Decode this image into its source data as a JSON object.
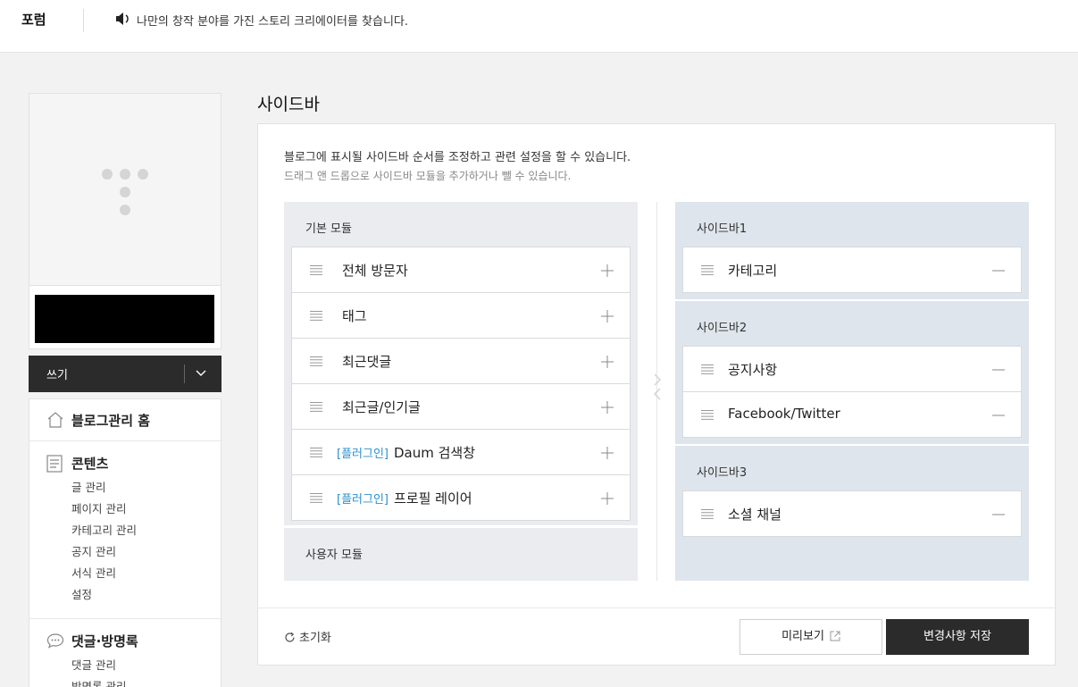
{
  "topbar": {
    "brand": "포럼",
    "notice": "나만의 창작 분야를 가진 스토리 크리에이터를 찾습니다."
  },
  "left": {
    "write_label": "쓰기",
    "home_label": "블로그관리 홈",
    "contents": {
      "title": "콘텐츠",
      "items": [
        "글 관리",
        "페이지 관리",
        "카테고리 관리",
        "공지 관리",
        "서식 관리",
        "설정"
      ]
    },
    "comments": {
      "title": "댓글·방명록",
      "items": [
        "댓글 관리",
        "방명록 관리"
      ]
    }
  },
  "main": {
    "title": "사이드바",
    "desc1": "블로그에 표시될 사이드바 순서를 조정하고 관련 설정을 할 수 있습니다.",
    "desc2": "드래그 앤 드롭으로 사이드바 모듈을 추가하거나 뺄 수 있습니다.",
    "basic_modules": {
      "title": "기본 모듈",
      "items": [
        {
          "tag": "",
          "label": "전체 방문자"
        },
        {
          "tag": "",
          "label": "태그"
        },
        {
          "tag": "",
          "label": "최근댓글"
        },
        {
          "tag": "",
          "label": "최근글/인기글"
        },
        {
          "tag": "[플러그인]",
          "label": "Daum 검색창"
        },
        {
          "tag": "[플러그인]",
          "label": "프로필 레이어"
        }
      ]
    },
    "user_modules": {
      "title": "사용자 모듈"
    },
    "sidebars": [
      {
        "title": "사이드바1",
        "items": [
          "카테고리"
        ]
      },
      {
        "title": "사이드바2",
        "items": [
          "공지사항",
          "Facebook/Twitter"
        ]
      },
      {
        "title": "사이드바3",
        "items": [
          "소셜 채널"
        ]
      }
    ],
    "footer": {
      "reset_label": "초기화",
      "preview_label": "미리보기",
      "save_label": "변경사항 저장"
    }
  },
  "colors": {
    "accent_tag": "#2a8fd1",
    "dark_button": "#2b2b2b",
    "basic_bg": "#eaecef",
    "sidebar_bg": "#dfe5ec"
  }
}
